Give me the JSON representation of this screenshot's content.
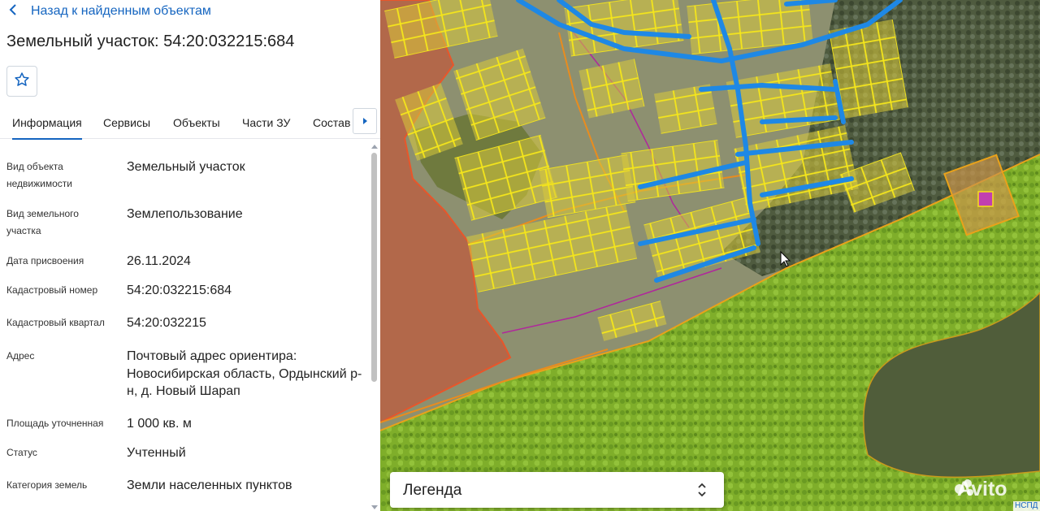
{
  "header": {
    "back_label": "Назад к найденным объектам",
    "title": "Земельный участок: 54:20:032215:684"
  },
  "tabs": [
    {
      "label": "Информация",
      "active": true
    },
    {
      "label": "Сервисы"
    },
    {
      "label": "Объекты"
    },
    {
      "label": "Части ЗУ"
    },
    {
      "label": "Состав"
    }
  ],
  "details": [
    {
      "key": "Вид объекта недвижимости",
      "value": "Земельный участок"
    },
    {
      "key": "Вид земельного участка",
      "value": "Землепользование"
    },
    {
      "key": "Дата присвоения",
      "value": "26.11.2024"
    },
    {
      "key": "Кадастровый номер",
      "value": "54:20:032215:684"
    },
    {
      "key": "Кадастровый квартал",
      "value": "54:20:032215"
    },
    {
      "key": "Адрес",
      "value": "Почтовый адрес ориентира: Новосибирская область, Ордынский р-н, д. Новый Шарап"
    },
    {
      "key": "Площадь уточненная",
      "value": "1 000 кв. м"
    },
    {
      "key": "Статус",
      "value": "Учтенный"
    },
    {
      "key": "Категория земель",
      "value": "Земли населенных пунктов"
    }
  ],
  "map": {
    "legend_label": "Легенда",
    "watermark": "Avito",
    "provider_badge": "НСПД"
  },
  "colors": {
    "accent": "#1565c0",
    "parcel_outline": "#f2e21a",
    "parcel_fill": "#f3e23a",
    "utility_lines": "#1e88e5",
    "forest_zone": "#8fbf2f",
    "field_zone": "#b0633f",
    "boundary": "#b0279c"
  }
}
